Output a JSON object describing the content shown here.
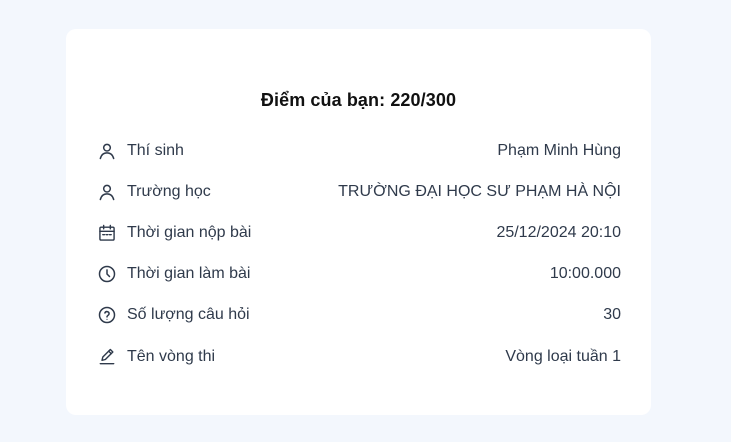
{
  "result": {
    "score_text": "Điểm của bạn: 220/300"
  },
  "rows": [
    {
      "icon": "user-icon",
      "label": "Thí sinh",
      "value": "Phạm Minh Hùng"
    },
    {
      "icon": "user-icon",
      "label": "Trường học",
      "value": "TRƯỜNG ĐẠI HỌC SƯ PHẠM HÀ NỘI"
    },
    {
      "icon": "calendar-icon",
      "label": "Thời gian nộp bài",
      "value": "25/12/2024 20:10"
    },
    {
      "icon": "clock-icon",
      "label": "Thời gian làm bài",
      "value": "10:00.000"
    },
    {
      "icon": "question-circle-icon",
      "label": "Số lượng câu hỏi",
      "value": "30"
    },
    {
      "icon": "pencil-icon",
      "label": "Tên vòng thi",
      "value": "Vòng loại tuần 1"
    }
  ]
}
